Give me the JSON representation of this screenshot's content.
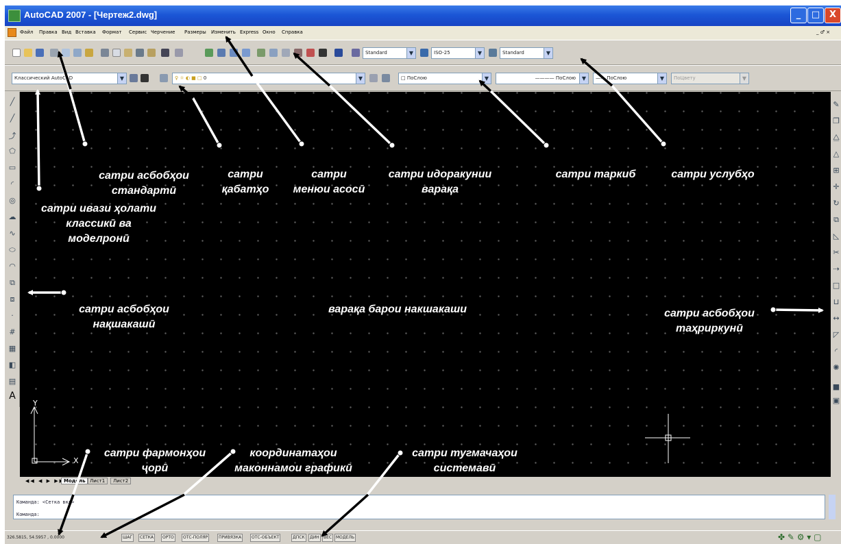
{
  "titlebar": {
    "title": "AutoCAD 2007 - [Чертеж2.dwg]",
    "min": "_",
    "max": "□",
    "close": "X"
  },
  "menu": [
    "Файл",
    "Правка",
    "Вид",
    "Вставка",
    "Формат",
    "Сервис",
    "Черчение",
    "Размеры",
    "Изменить",
    "Express",
    "Окно",
    "Справка"
  ],
  "menu_ctrl": "_ ♂ ×",
  "styles": {
    "text": "Standard",
    "dim": "ISO-25",
    "table": "Standard"
  },
  "workspace": "Классический AutoCAD",
  "layer": "0",
  "props": {
    "color": "ПоСлою",
    "linetype": "ПоСлою",
    "lineweight": "ПоСлою",
    "plotstyle": "ПоЦвету"
  },
  "tabs": [
    "Модель",
    "Лист1",
    "Лист2"
  ],
  "command": {
    "line1": "Команда:  <Сетка вкл>",
    "line2": "Команда:"
  },
  "coords": "326.5815, 54.5957 , 0.0000",
  "status_buttons": [
    "ШАГ",
    "СЕТКА",
    "ОРТО",
    "ОТС-ПОЛЯР",
    "ПРИВЯЗКА",
    "ОТС-ОБЪЕКТ",
    "ДПСК",
    "ДИН",
    "ВЕС",
    "МОДЕЛЬ"
  ],
  "ucs": {
    "y": "Y",
    "x": "X"
  },
  "labels": {
    "standard": "сатри асбобҳои\nстандартӣ",
    "layers": "сатри\nқабатҳо",
    "menu": "сатри\nменюи асосӣ",
    "sheet_control": "сатри идоракунии\nварақа",
    "props": "сатри таркиб",
    "styles": "сатри услубҳо",
    "workspace": "сатри ивази ҳолати\nклассикӣ ва\nмоделронӣ",
    "draw": "сатри асбобҳои\nнақшакашӣ",
    "drawing_area": "варақа барои накшакаши",
    "modify": "сатри асбобҳои\nтаҳриркунӣ",
    "commands": "сатри фармонҳои\nҷорӣ",
    "coords": "координатаҳои\nмаконнамои графикӣ",
    "system": "сатри тугмачаҳои\nсистемавӣ"
  },
  "colors": {
    "canvas": "#000000",
    "title": "#1b56d6",
    "chrome": "#d4d0c8"
  }
}
